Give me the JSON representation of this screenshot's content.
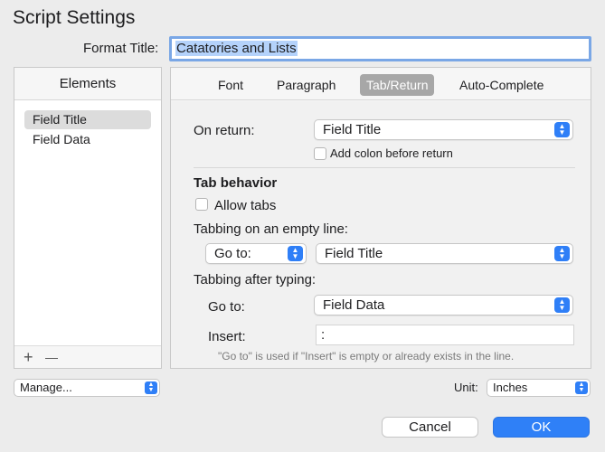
{
  "window": {
    "title": "Script Settings"
  },
  "format": {
    "label": "Format Title:",
    "value": "Catatories and Lists"
  },
  "elements": {
    "header": "Elements",
    "items": [
      {
        "label": "Field Title",
        "selected": true
      },
      {
        "label": "Field Data",
        "selected": false
      }
    ],
    "add_label": "+",
    "remove_label": "—"
  },
  "tabs": [
    {
      "label": "Font",
      "active": false
    },
    {
      "label": "Paragraph",
      "active": false
    },
    {
      "label": "Tab/Return",
      "active": true
    },
    {
      "label": "Auto-Complete",
      "active": false
    }
  ],
  "settings": {
    "on_return_label": "On return:",
    "on_return_value": "Field Title",
    "add_colon_label": "Add colon before return",
    "add_colon_checked": false,
    "tab_behavior_heading": "Tab behavior",
    "allow_tabs_label": "Allow tabs",
    "allow_tabs_checked": false,
    "empty_line_label": "Tabbing on an empty line:",
    "empty_line_action": "Go to:",
    "empty_line_target": "Field Title",
    "after_typing_label": "Tabbing after typing:",
    "goto_label": "Go to:",
    "goto_value": "Field Data",
    "insert_label": "Insert:",
    "insert_value": ":",
    "hint": "\"Go to\" is used if \"Insert\" is empty or already exists in the line."
  },
  "bottom": {
    "manage_label": "Manage...",
    "unit_label": "Unit:",
    "unit_value": "Inches",
    "cancel_label": "Cancel",
    "ok_label": "OK"
  },
  "colors": {
    "accent": "#2f80f7",
    "selection": "#b4d2fb",
    "active_tab": "#a7a7a7"
  }
}
